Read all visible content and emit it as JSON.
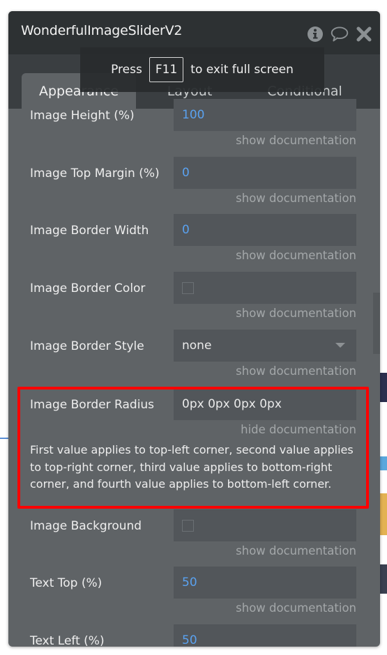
{
  "window": {
    "title": "WonderfulImageSliderV2",
    "icons": [
      "info-icon",
      "comment-icon",
      "close-icon"
    ]
  },
  "fullscreen_toast": {
    "prefix": "Press",
    "key": "F11",
    "suffix": "to exit full screen"
  },
  "tabs": [
    {
      "label": "Appearance",
      "active": true
    },
    {
      "label": "Layout",
      "active": false
    },
    {
      "label": "Conditional",
      "active": false
    }
  ],
  "fields": [
    {
      "label": "Image Height (%)",
      "value": "100",
      "type": "number",
      "doc_link": "show documentation"
    },
    {
      "label": "Image Top Margin (%)",
      "value": "0",
      "type": "number",
      "doc_link": "show documentation"
    },
    {
      "label": "Image Border Width",
      "value": "0",
      "type": "number",
      "doc_link": "show documentation"
    },
    {
      "label": "Image Border Color",
      "value": "",
      "type": "color",
      "doc_link": "show documentation"
    },
    {
      "label": "Image Border Style",
      "value": "none",
      "type": "dropdown",
      "doc_link": "show documentation"
    },
    {
      "label": "Image Border Radius",
      "value": "0px 0px 0px 0px",
      "type": "text",
      "doc_link": "hide documentation",
      "documentation": "First value applies to top-left corner, second value applies to top-right corner, third value applies to bottom-right corner, and fourth value applies to bottom-left corner."
    },
    {
      "label": "Image Background",
      "value": "",
      "type": "color",
      "doc_link": "show documentation"
    },
    {
      "label": "Text Top (%)",
      "value": "50",
      "type": "number",
      "doc_link": "show documentation"
    },
    {
      "label": "Text Left (%)",
      "value": "50",
      "type": "number",
      "doc_link": ""
    }
  ],
  "colors": {
    "panel_bg": "#5f6366",
    "header_bg": "#2d3133",
    "field_bg": "#52565a",
    "number_value": "#5aa2f0",
    "highlight_border": "#ff0000"
  }
}
